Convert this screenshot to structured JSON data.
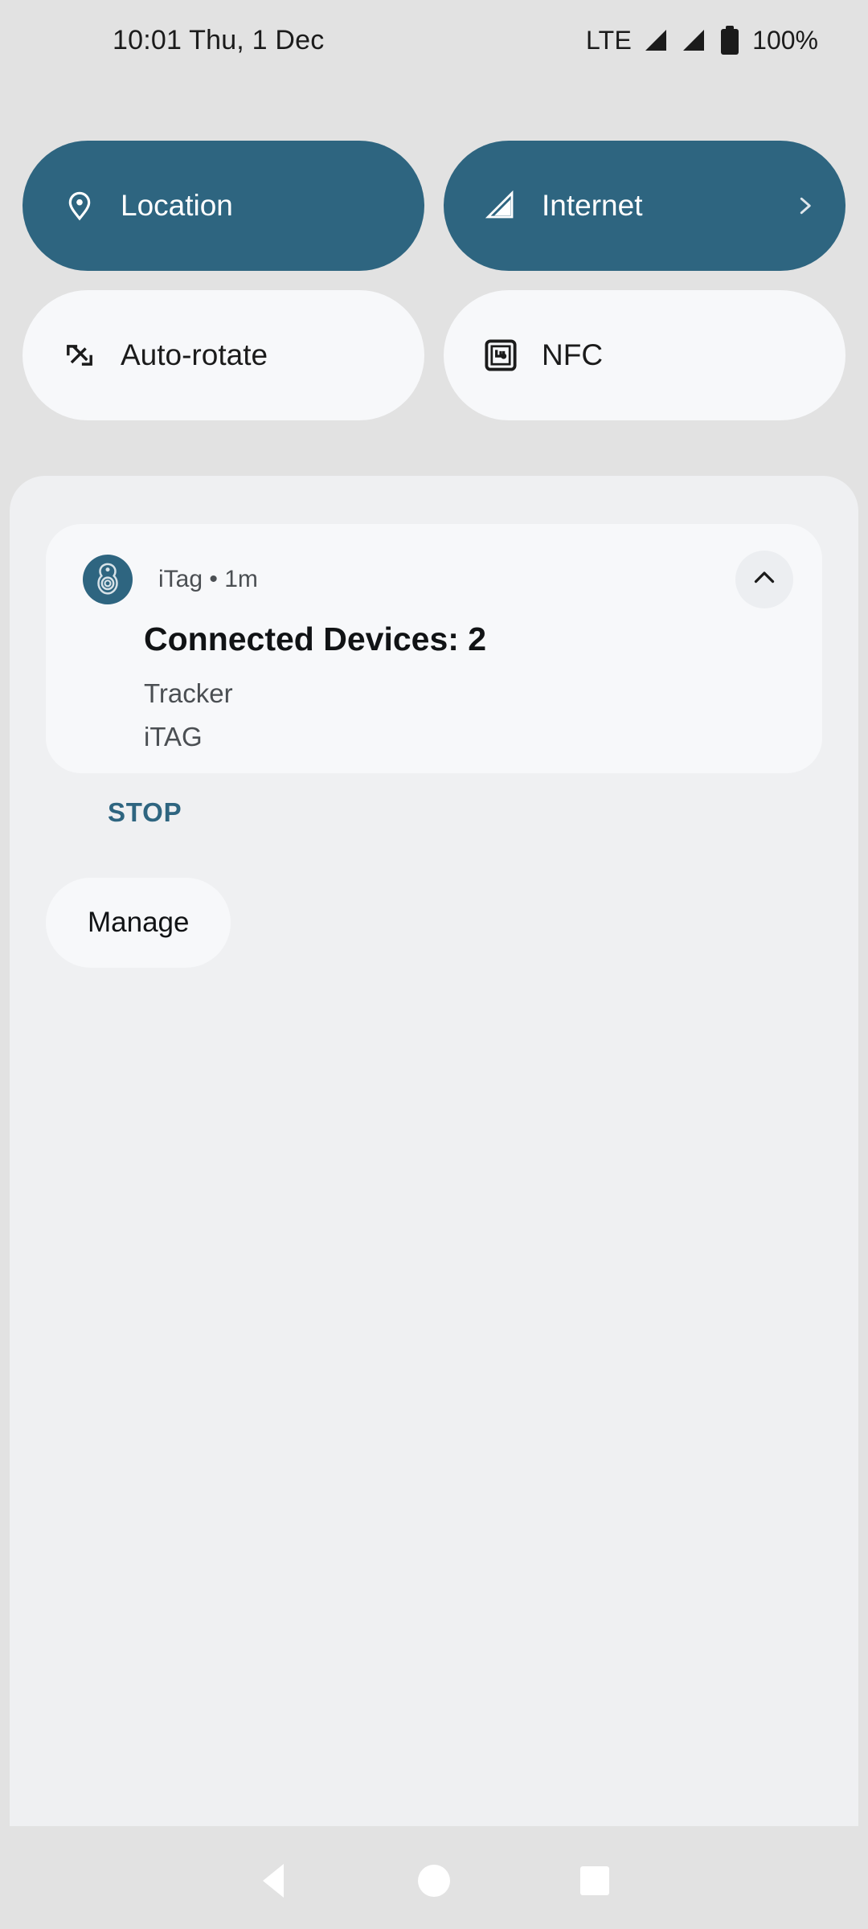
{
  "status_bar": {
    "clock": "10:01 Thu, 1 Dec",
    "network_type": "LTE",
    "signal_icon_1": "signal-bars-icon",
    "signal_icon_2": "signal-bars-icon",
    "battery_icon": "battery-full-icon",
    "battery_percent": "100%"
  },
  "quick_settings": {
    "tiles": [
      {
        "label": "Location",
        "icon": "location-pin-icon",
        "state": "on",
        "has_chevron": false
      },
      {
        "label": "Internet",
        "icon": "signal-bars-icon",
        "state": "on",
        "has_chevron": true,
        "chevron": "chevron-right-icon"
      },
      {
        "label": "Auto-rotate",
        "icon": "auto-rotate-icon",
        "state": "off",
        "has_chevron": false
      },
      {
        "label": "NFC",
        "icon": "nfc-icon",
        "state": "off",
        "has_chevron": false
      }
    ]
  },
  "notification": {
    "app_icon": "itag-tracker-icon",
    "app_name": "iTag",
    "separator": "•",
    "time": "1m",
    "header_text": "iTag • 1m",
    "collapse_icon": "chevron-up-icon",
    "title": "Connected Devices: 2",
    "lines": [
      "Tracker",
      "iTAG"
    ],
    "action_label": "STOP"
  },
  "manage": {
    "label": "Manage"
  },
  "nav_bar": {
    "back": "back-triangle-icon",
    "home": "home-circle-icon",
    "recents": "recents-square-icon"
  },
  "colors": {
    "accent": "#2e6580",
    "shade_bg": "#eff0f2",
    "card_bg": "#f7f8fa",
    "screen_bg": "#e2e2e2"
  }
}
